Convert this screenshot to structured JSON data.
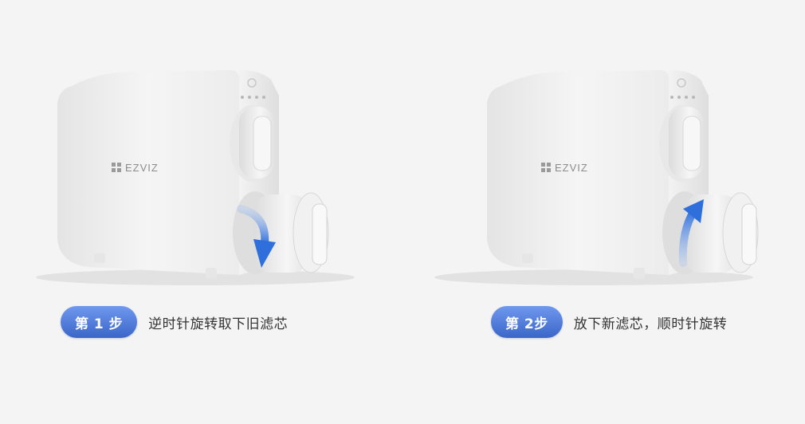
{
  "colors": {
    "background": "#f4f4f4",
    "badge_top": "#6f98ee",
    "badge_bottom": "#3a66c8",
    "arrow": "#3a78e0",
    "text": "#333333"
  },
  "steps": [
    {
      "badge": "第 1 步",
      "caption": "逆时针旋转取下旧滤芯",
      "brand": "EZVIZ",
      "arrow_icon": "counterclockwise-down-arrow"
    },
    {
      "badge": "第 2步",
      "caption": "放下新滤芯，顺时针旋转",
      "brand": "EZVIZ",
      "arrow_icon": "clockwise-up-arrow"
    }
  ]
}
